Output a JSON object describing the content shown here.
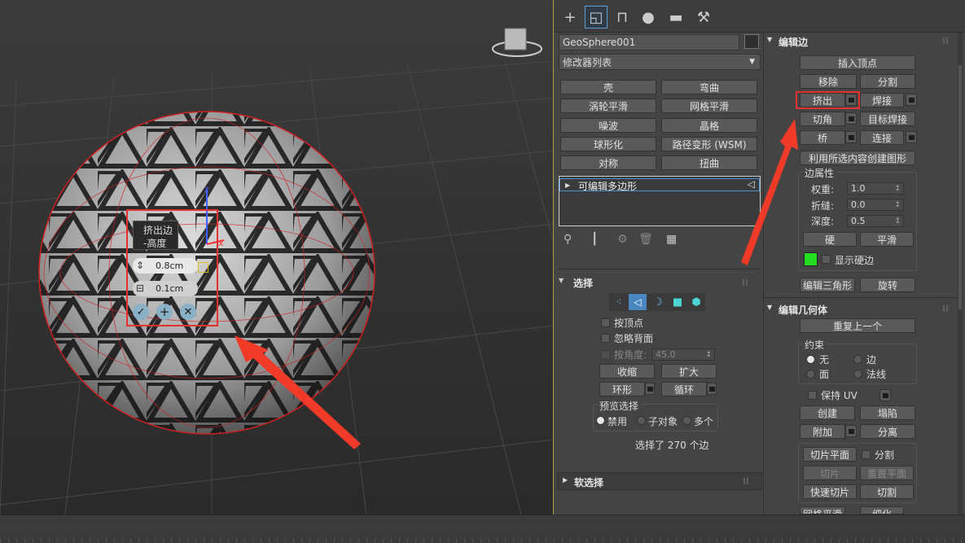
{
  "object_name": "GeoSphere001",
  "modifier_list": "修改器列表",
  "modifiers": [
    "壳",
    "弯曲",
    "涡轮平滑",
    "网格平滑",
    "噪波",
    "晶格",
    "球形化",
    "路径变形 (WSM)",
    "对称",
    "扭曲"
  ],
  "stack_item": "可编辑多边形",
  "caddy": {
    "title": "挤出边",
    "subtitle": "-高度",
    "height_value": "0.8cm",
    "width_value": "0.1cm"
  },
  "selection": {
    "header": "选择",
    "by_vertex": "按顶点",
    "ignore_backface": "忽略背面",
    "by_angle": "按角度:",
    "angle_value": "45.0",
    "shrink": "收缩",
    "grow": "扩大",
    "ring": "环形",
    "loop": "循环",
    "preview_label": "预览选择",
    "preview_off": "禁用",
    "preview_sub": "子对象",
    "preview_multi": "多个",
    "status": "选择了 270 个边"
  },
  "soft_selection": "软选择",
  "edit_edges": {
    "header": "编辑边",
    "insert_vertex": "插入顶点",
    "remove": "移除",
    "split": "分割",
    "extrude": "挤出",
    "weld": "焊接",
    "chamfer": "切角",
    "target_weld": "目标焊接",
    "bridge": "桥",
    "connect": "连接",
    "create_shape": "利用所选内容创建图形",
    "edge_props": "边属性",
    "weight_label": "权重:",
    "weight": "1.0",
    "crease_label": "折缝:",
    "crease": "0.0",
    "depth_label": "深度:",
    "depth": "0.5",
    "hard": "硬",
    "smooth": "平滑",
    "show_hard": "显示硬边",
    "edit_tri": "编辑三角形",
    "turn": "旋转"
  },
  "edit_geometry": {
    "header": "编辑几何体",
    "repeat_last": "重复上一个",
    "constraints": "约束",
    "c_none": "无",
    "c_edge": "边",
    "c_face": "面",
    "c_normal": "法线",
    "preserve_uv": "保持 UV",
    "create": "创建",
    "collapse": "塌陷",
    "attach": "附加",
    "detach": "分离",
    "slice_plane": "切片平面",
    "split": "分割",
    "slice": "切片",
    "reset_plane": "重置平面",
    "quickslice": "快速切片",
    "cut": "切割",
    "meshsmooth": "网格平滑",
    "tessellate": "细化"
  },
  "colors": {
    "accent_red": "#e53030",
    "hard_edge_green": "#22dd22",
    "active_tab": "#59a0d8"
  },
  "icons": [
    "create-icon",
    "modify-icon",
    "hierarchy-icon",
    "motion-icon",
    "display-icon",
    "utilities-icon"
  ]
}
